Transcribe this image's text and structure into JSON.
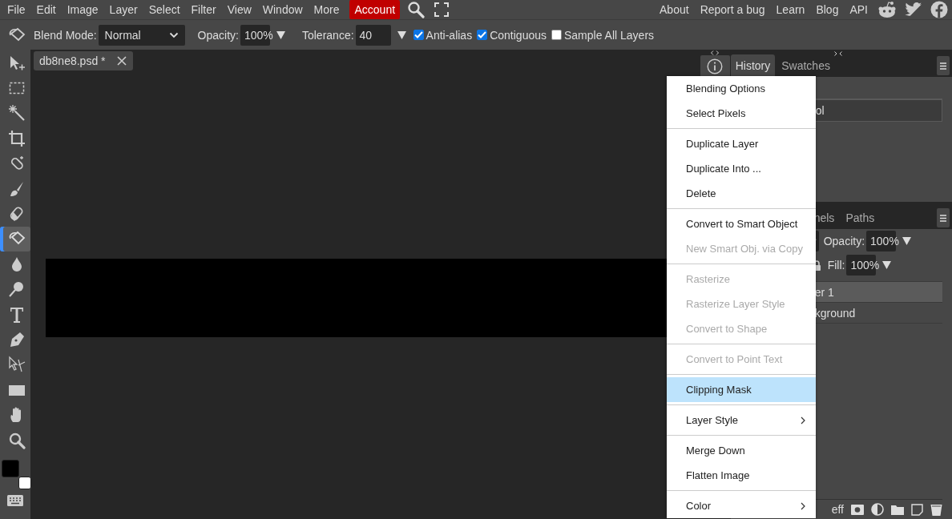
{
  "menubar": {
    "items": [
      {
        "label": "File",
        "kind": "menu"
      },
      {
        "label": "Edit",
        "kind": "menu"
      },
      {
        "label": "Image",
        "kind": "menu"
      },
      {
        "label": "Layer",
        "kind": "menu"
      },
      {
        "label": "Select",
        "kind": "menu"
      },
      {
        "label": "Filter",
        "kind": "menu"
      },
      {
        "label": "View",
        "kind": "menu"
      },
      {
        "label": "Window",
        "kind": "menu"
      },
      {
        "label": "More",
        "kind": "menu"
      },
      {
        "label": "Account",
        "kind": "account"
      }
    ],
    "links": [
      "About",
      "Report a bug",
      "Learn",
      "Blog",
      "API"
    ]
  },
  "options_bar": {
    "blend_mode": {
      "label": "Blend Mode:",
      "value": "Normal"
    },
    "opacity": {
      "label": "Opacity:",
      "value": "100%"
    },
    "tolerance": {
      "label": "Tolerance:",
      "value": "40"
    },
    "checkboxes": [
      {
        "label": "Anti-alias",
        "checked": true
      },
      {
        "label": "Contiguous",
        "checked": true
      },
      {
        "label": "Sample All Layers",
        "checked": false
      }
    ]
  },
  "tools": [
    {
      "kind": "move",
      "selected": false
    },
    {
      "kind": "marquee",
      "selected": false
    },
    {
      "kind": "wand",
      "selected": false
    },
    {
      "kind": "crop",
      "selected": false
    },
    {
      "kind": "heal",
      "selected": false
    },
    {
      "kind": "brush",
      "selected": false
    },
    {
      "kind": "eraser",
      "selected": false
    },
    {
      "kind": "bucket",
      "selected": true
    },
    {
      "kind": "drop",
      "selected": false
    },
    {
      "kind": "dodge",
      "selected": false
    },
    {
      "kind": "text",
      "selected": false
    },
    {
      "kind": "pen",
      "selected": false
    },
    {
      "kind": "path",
      "selected": false
    },
    {
      "kind": "shape",
      "selected": false
    },
    {
      "kind": "hand",
      "selected": false
    },
    {
      "kind": "zoom",
      "selected": false
    }
  ],
  "swatches": [
    {
      "color": "#000000"
    },
    {
      "color": "#ffffff"
    }
  ],
  "document_tab": {
    "title": "db8ne8.psd *"
  },
  "history_panel": {
    "tabs": [
      {
        "label": "History",
        "selected": true
      },
      {
        "label": "Swatches",
        "selected": false
      }
    ],
    "rows": [
      {
        "label": "",
        "selected": false
      },
      {
        "label": "ol",
        "selected": true
      }
    ]
  },
  "layers_panel": {
    "tabs": [
      {
        "label": "nels",
        "selected": false
      },
      {
        "label": "Paths",
        "selected": false
      }
    ],
    "opacity": {
      "label": "Opacity:",
      "value": "100%"
    },
    "fill": {
      "label": "Fill:",
      "value": "100%"
    },
    "layers": [
      {
        "name": "er 1",
        "selected": true
      },
      {
        "name": "kground",
        "selected": false
      }
    ],
    "effects_label": "eff"
  },
  "context_menu": {
    "groups": [
      [
        {
          "label": "Blending Options",
          "disabled": false,
          "selected": false,
          "submenu": false
        },
        {
          "label": "Select Pixels",
          "disabled": false,
          "selected": false,
          "submenu": false
        }
      ],
      [
        {
          "label": "Duplicate Layer",
          "disabled": false,
          "selected": false,
          "submenu": false
        },
        {
          "label": "Duplicate Into ...",
          "disabled": false,
          "selected": false,
          "submenu": false
        },
        {
          "label": "Delete",
          "disabled": false,
          "selected": false,
          "submenu": false
        }
      ],
      [
        {
          "label": "Convert to Smart Object",
          "disabled": false,
          "selected": false,
          "submenu": false
        },
        {
          "label": "New Smart Obj. via Copy",
          "disabled": true,
          "selected": false,
          "submenu": false
        }
      ],
      [
        {
          "label": "Rasterize",
          "disabled": true,
          "selected": false,
          "submenu": false
        },
        {
          "label": "Rasterize Layer Style",
          "disabled": true,
          "selected": false,
          "submenu": false
        },
        {
          "label": "Convert to Shape",
          "disabled": true,
          "selected": false,
          "submenu": false
        }
      ],
      [
        {
          "label": "Convert to Point Text",
          "disabled": true,
          "selected": false,
          "submenu": false
        }
      ],
      [
        {
          "label": "Clipping Mask",
          "disabled": false,
          "selected": true,
          "submenu": false
        }
      ],
      [
        {
          "label": "Layer Style",
          "disabled": false,
          "selected": false,
          "submenu": true
        }
      ],
      [
        {
          "label": "Merge Down",
          "disabled": false,
          "selected": false,
          "submenu": false
        },
        {
          "label": "Flatten Image",
          "disabled": false,
          "selected": false,
          "submenu": false
        }
      ],
      [
        {
          "label": "Color",
          "disabled": false,
          "selected": false,
          "submenu": true
        }
      ]
    ]
  }
}
